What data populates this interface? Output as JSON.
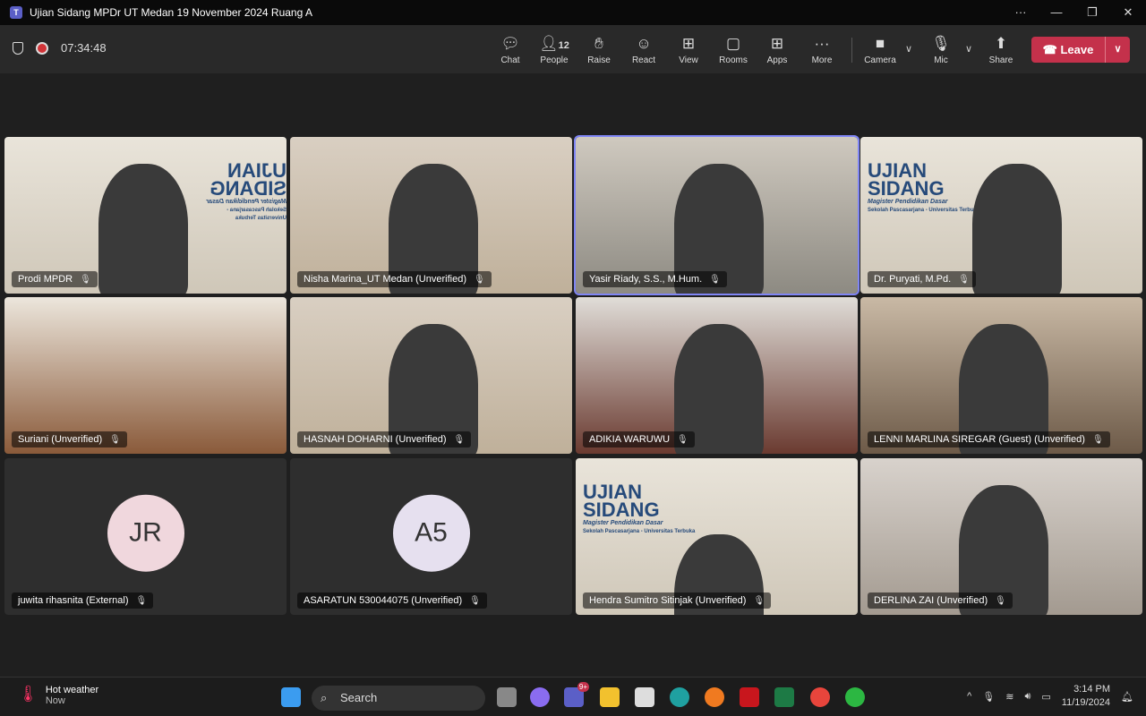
{
  "window": {
    "title": "Ujian Sidang MPDr UT Medan 19 November 2024 Ruang A",
    "more": "···",
    "minimize": "—",
    "restore": "❐",
    "close": "✕"
  },
  "toolbar": {
    "timer": "07:34:48",
    "people_count": "12",
    "buttons": [
      {
        "label": "Chat",
        "icon": "chat-icon"
      },
      {
        "label": "People",
        "icon": "people-icon"
      },
      {
        "label": "Raise",
        "icon": "hand-icon"
      },
      {
        "label": "React",
        "icon": "smile-icon"
      },
      {
        "label": "View",
        "icon": "grid-icon"
      },
      {
        "label": "Rooms",
        "icon": "rooms-icon"
      },
      {
        "label": "Apps",
        "icon": "apps-icon"
      },
      {
        "label": "More",
        "icon": "more-icon"
      },
      {
        "label": "Camera",
        "icon": "camera-icon"
      },
      {
        "label": "Mic",
        "icon": "mic-off-icon"
      },
      {
        "label": "Share",
        "icon": "share-icon"
      }
    ],
    "leave": "Leave",
    "leave_color": "#c4314b"
  },
  "participants": [
    {
      "name": "Prodi MPDR",
      "type": "banner"
    },
    {
      "name": "Nisha Marina_UT Medan (Unverified)",
      "type": "video"
    },
    {
      "name": "Yasir Riady, S.S., M.Hum.",
      "type": "video",
      "active": true
    },
    {
      "name": "Dr. Puryati, M.Pd.",
      "type": "banner"
    },
    {
      "name": "Suriani (Unverified)",
      "type": "video"
    },
    {
      "name": "HASNAH DOHARNI (Unverified)",
      "type": "video"
    },
    {
      "name": "ADIKIA WARUWU",
      "type": "video"
    },
    {
      "name": "LENNI MARLINA SIREGAR (Guest) (Unverified)",
      "type": "video"
    },
    {
      "name": "juwita rihasnita (External)",
      "type": "avatar",
      "initials": "JR",
      "color": "#f0d7dd"
    },
    {
      "name": "ASARATUN 530044075 (Unverified)",
      "type": "avatar",
      "initials": "A5",
      "color": "#e6e0ef"
    },
    {
      "name": "Hendra Sumitro Sitinjak (Unverified)",
      "type": "banner"
    },
    {
      "name": "DERLINA ZAI (Unverified)",
      "type": "video"
    }
  ],
  "banner": {
    "line1": "UJIAN",
    "line2": "SIDANG",
    "sub1": "Magister Pendidikan Dasar",
    "sub2": "Sekolah Pascasarjana - Universitas Terbuka"
  },
  "taskbar": {
    "weather_title": "Hot weather",
    "weather_sub": "Now",
    "search": "Search",
    "teams_badge": "9+",
    "time": "3:14 PM",
    "date": "11/19/2024"
  }
}
